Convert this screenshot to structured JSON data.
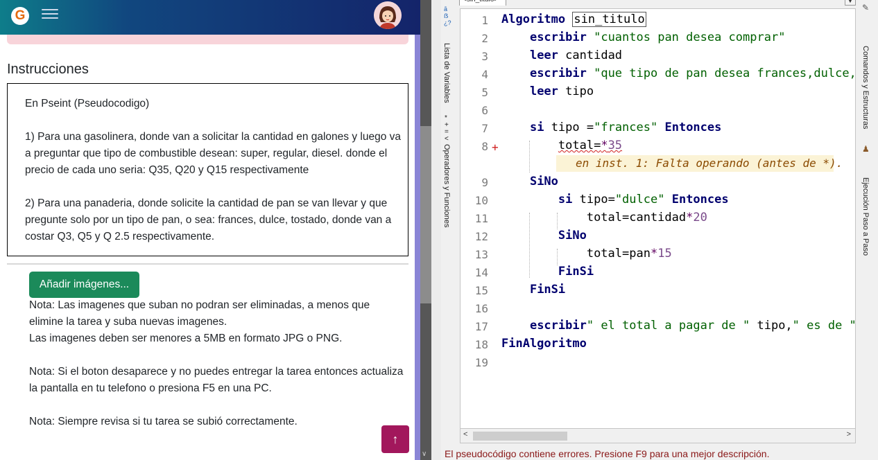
{
  "browser": {
    "logo_letter": "G",
    "instructions_title": "Instrucciones",
    "instructions": [
      "En Pseint (Pseudocodigo)",
      "1) Para una gasolinera, donde van a solicitar la cantidad en galones y luego va a preguntar que tipo de combustible desean: super, regular, diesel. donde el precio de cada uno seria: Q35, Q20 y Q15 respectivamente",
      "2) Para una panaderia, donde solicite la cantidad de pan se van llevar y que pregunte solo por un tipo de pan, o sea: frances, dulce, tostado, donde van a costar Q3, Q5 y Q 2.5 respectivamente."
    ],
    "add_images_label": "Añadir imágenes...",
    "notes": [
      "Nota: Las imagenes que suban no podran ser eliminadas, a menos que elimine la tarea y suba nuevas imagenes.",
      "Las imagenes deben ser menores a 5MB en formato JPG o PNG.",
      "Nota: Si el boton desaparece y no puedes entregar la tarea entonces actualiza la pantalla en tu telefono o presiona F5 en una PC.",
      "Nota: Siempre revisa si tu tarea se subió correctamente."
    ],
    "scroll_top_icon": "↑",
    "colors": {
      "primary_button": "#1b8a5a",
      "scroll_top": "#a2175c",
      "alert_bg": "#f8d4da"
    }
  },
  "pseint": {
    "tab_label": "<sin_titulo>",
    "left_sidebar": [
      "Lista de Variables",
      "Operadores y Funciones"
    ],
    "right_sidebar": [
      "Comandos y Estructuras",
      "Ejecución Paso a Paso"
    ],
    "line_numbers": [
      "1",
      "2",
      "3",
      "4",
      "5",
      "6",
      "7",
      "8",
      "9",
      "10",
      "11",
      "12",
      "13",
      "14",
      "15",
      "16",
      "17",
      "18",
      "19"
    ],
    "code": {
      "l1_kw": "Algoritmo",
      "l1_name": "sin_titulo",
      "l2_kw": "escribir",
      "l2_str": "\"cuantos pan desea comprar\"",
      "l3_kw": "leer",
      "l3_rest": "cantidad",
      "l4_kw": "escribir",
      "l4_str": "\"que tipo de pan desea frances,dulce,",
      "l5_kw": "leer",
      "l5_rest": "tipo",
      "l7_kw": "si",
      "l7_a": "tipo =",
      "l7_str": "\"frances\"",
      "l7_kw2": "Entonces",
      "l8_a": "total=",
      "l8_op": "*",
      "l8_num": "35",
      "error_msg": "en inst. 1: Falta operando (antes de *).",
      "l9_kw": "SiNo",
      "l10_kw": "si",
      "l10_a": "tipo=",
      "l10_str": "\"dulce\"",
      "l10_kw2": "Entonces",
      "l11_a": "total=cantidad",
      "l11_op": "*",
      "l11_num": "20",
      "l12_kw": "SiNo",
      "l13_a": "total=pan",
      "l13_op": "*",
      "l13_num": "15",
      "l14_kw": "FinSi",
      "l15_kw": "FinSi",
      "l17_kw": "escribir",
      "l17_str1": "\" el total a pagar de \"",
      "l17_a": " tipo,",
      "l17_str2": "\" es de \"",
      "l18_kw": "FinAlgoritmo"
    },
    "error_marker": "+",
    "status_message": "El pseudocódigo contiene errores. Presione F9 para una mejor descripción."
  }
}
